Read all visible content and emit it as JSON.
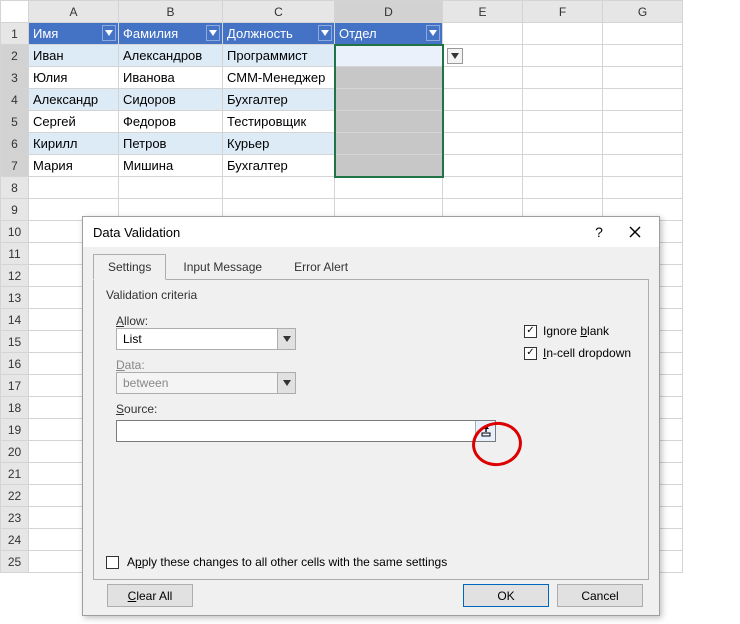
{
  "columns": [
    "A",
    "B",
    "C",
    "D",
    "E",
    "F",
    "G"
  ],
  "rowCount": 25,
  "headers": {
    "a": "Имя",
    "b": "Фамилия",
    "c": "Должность",
    "d": "Отдел"
  },
  "rows": [
    {
      "a": "Иван",
      "b": "Александров",
      "c": "Программист"
    },
    {
      "a": "Юлия",
      "b": "Иванова",
      "c": "СММ-Менеджер"
    },
    {
      "a": "Александр",
      "b": "Сидоров",
      "c": "Бухгалтер"
    },
    {
      "a": "Сергей",
      "b": "Федоров",
      "c": "Тестировщик"
    },
    {
      "a": "Кирилл",
      "b": "Петров",
      "c": "Курьер"
    },
    {
      "a": "Мария",
      "b": "Мишина",
      "c": "Бухгалтер"
    }
  ],
  "dialog": {
    "title": "Data Validation",
    "tabs": {
      "settings": "Settings",
      "input_message": "Input Message",
      "error_alert": "Error Alert"
    },
    "criteria_label": "Validation criteria",
    "allow_label": "Allow:",
    "allow_value": "List",
    "ignore_blank": "Ignore blank",
    "incell_dropdown": "In-cell dropdown",
    "data_label": "Data:",
    "data_value": "between",
    "source_label": "Source:",
    "source_value": "",
    "apply_label": "Apply these changes to all other cells with the same settings",
    "clear_all": "Clear All",
    "ok": "OK",
    "cancel": "Cancel"
  }
}
